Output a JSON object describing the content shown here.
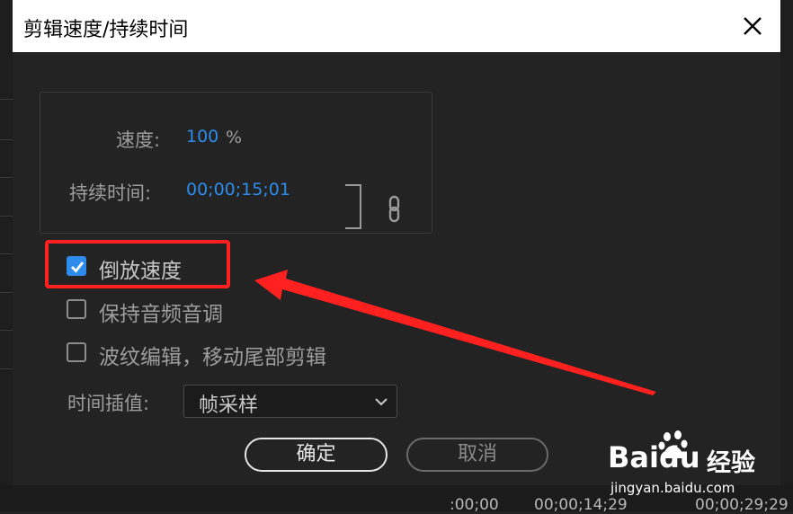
{
  "dialog": {
    "title": "剪辑速度/持续时间",
    "speed_label": "速度:",
    "speed_value": "100",
    "speed_unit": "%",
    "duration_label": "持续时间:",
    "duration_value": "00;00;15;01",
    "reverse_label": "倒放速度",
    "reverse_checked": true,
    "maintain_pitch_label": "保持音频音调",
    "maintain_pitch_checked": false,
    "ripple_label": "波纹编辑，移动尾部剪辑",
    "ripple_checked": false,
    "interp_label": "时间插值:",
    "interp_value": "帧采样",
    "ok_label": "确定",
    "cancel_label": "取消"
  },
  "timeline": {
    "timecodes": [
      ":00;00",
      "00;00;14;29",
      "00;00;29;29"
    ]
  },
  "watermark": {
    "brand": "Baidu",
    "brand_cn": "经验",
    "site": "jingyan.baidu.com"
  },
  "colors": {
    "accent": "#2d8ceb",
    "annotation_red": "#ff2020",
    "dialog_bg": "#232323",
    "titlebar_bg": "#ffffff"
  },
  "icons": {
    "close": "close-icon",
    "link": "link-icon",
    "chevron": "chevron-down-icon",
    "check": "checkmark-icon"
  }
}
